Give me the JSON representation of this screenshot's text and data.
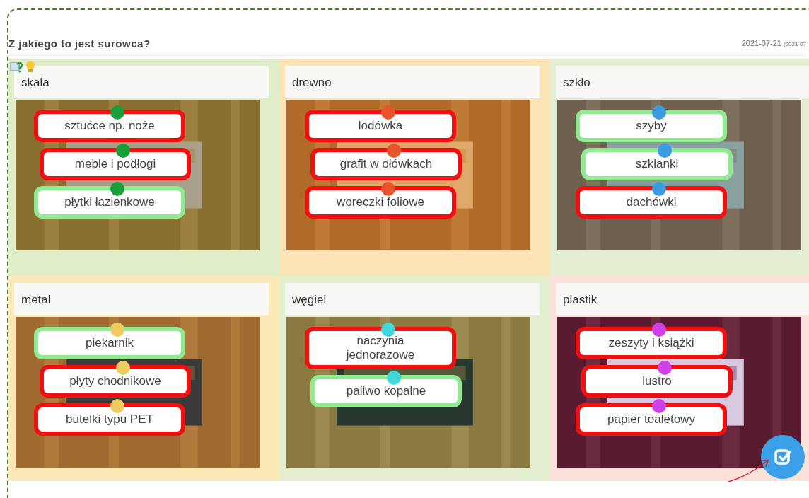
{
  "title": "Z jakiego to jest surowca?",
  "date": "2021-07-21",
  "date_secondary": "(2021-07",
  "categories": [
    {
      "name": "skała",
      "color": "#1a9e3a",
      "cards": [
        {
          "text": "sztućce np. noże",
          "correct": false
        },
        {
          "text": "meble i podłogi",
          "correct": false
        },
        {
          "text": "płytki łazienkowe",
          "correct": true
        }
      ]
    },
    {
      "name": "drewno",
      "color": "#e8542a",
      "cards": [
        {
          "text": "lodówka",
          "correct": false
        },
        {
          "text": "grafit w ołówkach",
          "correct": false
        },
        {
          "text": "woreczki foliowe",
          "correct": false
        }
      ]
    },
    {
      "name": "szkło",
      "color": "#3a9be0",
      "cards": [
        {
          "text": "szyby",
          "correct": true
        },
        {
          "text": "szklanki",
          "correct": true
        },
        {
          "text": "dachówki",
          "correct": false
        }
      ]
    },
    {
      "name": "metal",
      "color": "#f0cc60",
      "cards": [
        {
          "text": "piekarnik",
          "correct": true
        },
        {
          "text": "płyty chodnikowe",
          "correct": false
        },
        {
          "text": "butelki typu PET",
          "correct": false
        }
      ]
    },
    {
      "name": "węgiel",
      "color": "#40d8d8",
      "cards": [
        {
          "text": "naczynia jednorazowe",
          "correct": false
        },
        {
          "text": "paliwo kopalne",
          "correct": true
        }
      ]
    },
    {
      "name": "plastik",
      "color": "#d040e8",
      "cards": [
        {
          "text": "zeszyty i książki",
          "correct": false
        },
        {
          "text": "lustro",
          "correct": false
        },
        {
          "text": "papier toaletowy",
          "correct": false
        }
      ]
    }
  ]
}
